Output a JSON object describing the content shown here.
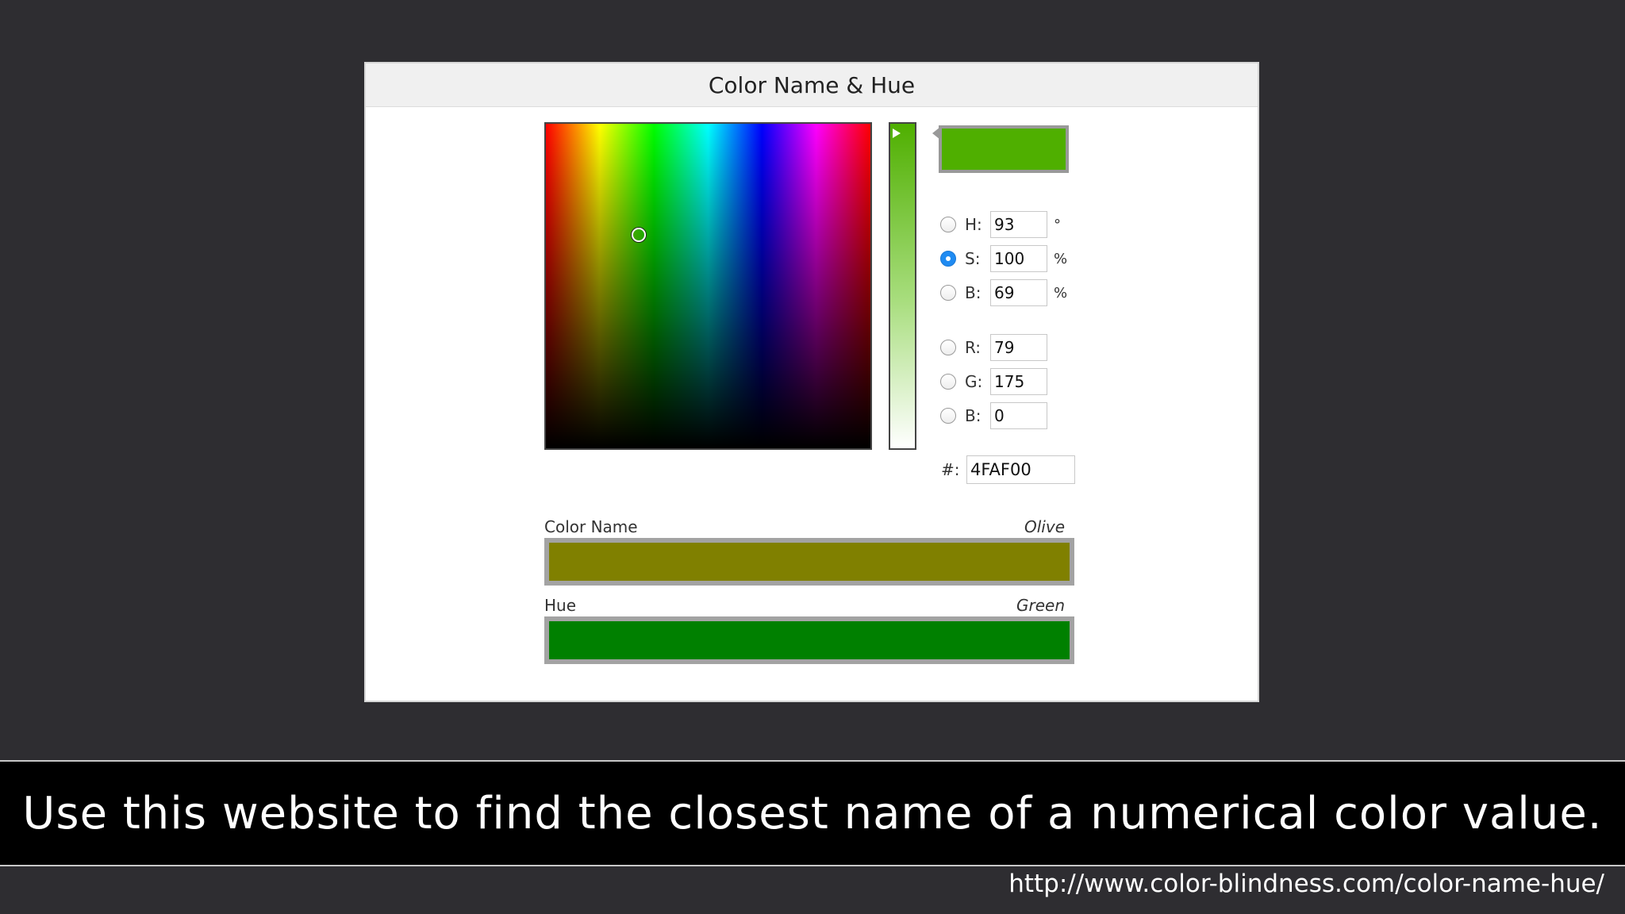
{
  "window": {
    "title": "Color Name & Hue"
  },
  "picker": {
    "preview_color": "#4faf00",
    "fields": [
      {
        "label": "H:",
        "value": "93",
        "unit": "°",
        "checked": false
      },
      {
        "label": "S:",
        "value": "100",
        "unit": "%",
        "checked": true
      },
      {
        "label": "B:",
        "value": "69",
        "unit": "%",
        "checked": false
      },
      {
        "label": "R:",
        "value": "79",
        "unit": "",
        "checked": false
      },
      {
        "label": "G:",
        "value": "175",
        "unit": "",
        "checked": false
      },
      {
        "label": "B:",
        "value": "0",
        "unit": "",
        "checked": false
      }
    ],
    "hex": {
      "label": "#:",
      "value": "4FAF00"
    }
  },
  "results": {
    "color_name": {
      "label": "Color Name",
      "value": "Olive",
      "color": "#808000"
    },
    "hue": {
      "label": "Hue",
      "value": "Green",
      "color": "#008000"
    }
  },
  "caption": "Use this website to find the closest name of a numerical color value.",
  "source_url": "http://www.color-blindness.com/color-name-hue/"
}
